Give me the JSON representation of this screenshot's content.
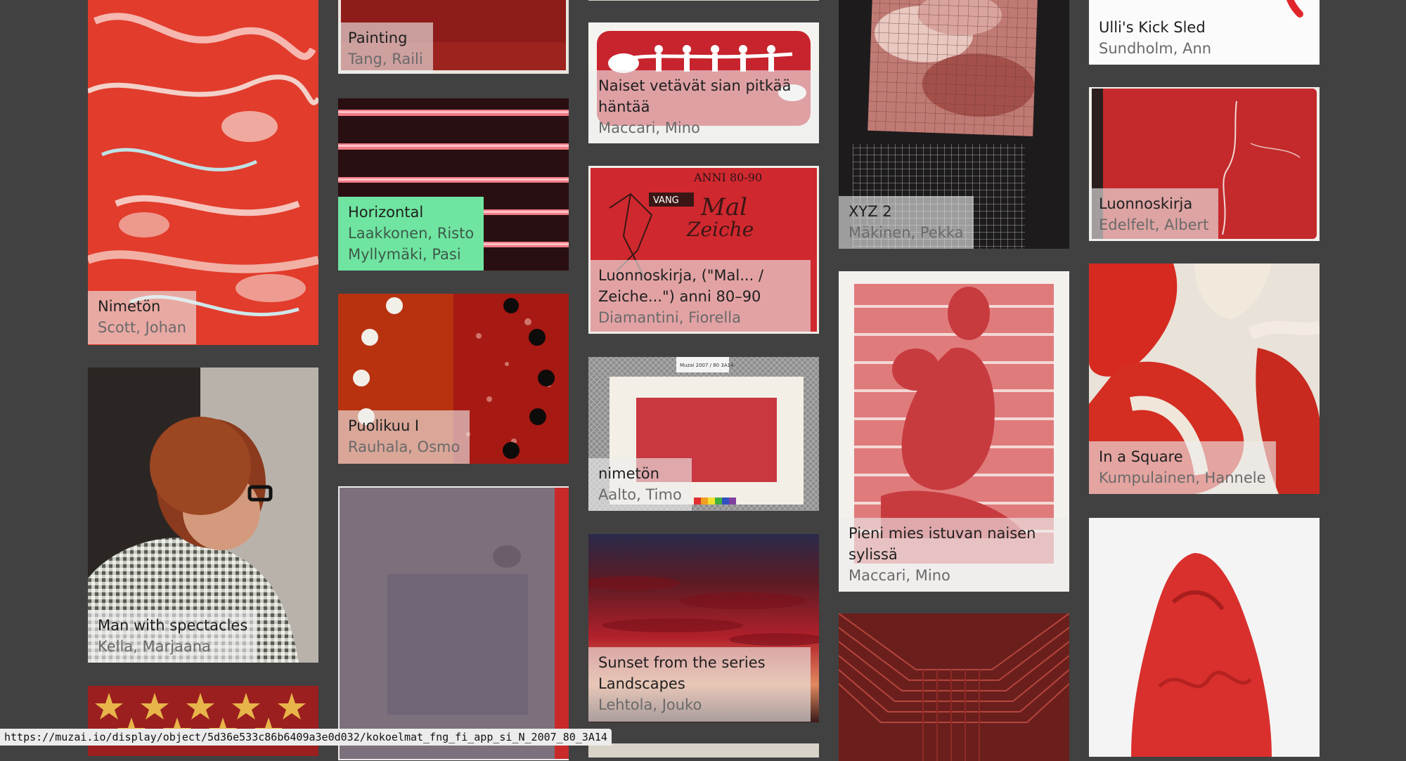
{
  "cards": [
    {
      "title": "Nimetön",
      "artists": [
        "Scott, Johan"
      ]
    },
    {
      "title": "Man with spectacles",
      "artists": [
        "Kella, Marjaana"
      ]
    },
    {
      "title": "Painting",
      "artists": [
        "Tang, Raili"
      ]
    },
    {
      "title": "Horizontal",
      "artists": [
        "Laakkonen, Risto",
        "Myllymäki, Pasi"
      ]
    },
    {
      "title": "Puolikuu I",
      "artists": [
        "Rauhala, Osmo"
      ]
    },
    {
      "title": "Naiset vetävät sian pitkää häntää",
      "artists": [
        "Maccari, Mino"
      ]
    },
    {
      "title": "Luonnoskirja, (\"Mal... / Zeiche...\") anni 80–90",
      "artists": [
        "Diamantini, Fiorella"
      ]
    },
    {
      "title": "nimetön",
      "artists": [
        "Aalto, Timo"
      ]
    },
    {
      "title": "Sunset from the series Landscapes",
      "artists": [
        "Lehtola, Jouko"
      ]
    },
    {
      "title": "XYZ 2",
      "artists": [
        "Mäkinen, Pekka"
      ]
    },
    {
      "title": "Pieni mies istuvan naisen sylissä",
      "artists": [
        "Maccari, Mino"
      ]
    },
    {
      "title": "Ulli's Kick Sled",
      "artists": [
        "Sundholm, Ann"
      ]
    },
    {
      "title": "Luonnoskirja",
      "artists": [
        "Edelfelt, Albert"
      ]
    },
    {
      "title": "In a Square",
      "artists": [
        "Kumpulainen, Hannele"
      ]
    }
  ],
  "sketch_cover_text": {
    "line1": "ANNI 80-90",
    "tag": "VANG",
    "line2": "Mal",
    "line3": "Zeiche"
  },
  "label_sticker_text": "Muzai 2007 / 80 3A14",
  "status_url": "https://muzai.io/display/object/5d36e533c86b6409a3e0d032/kokoelmat_fng_fi_app_si_N_2007_80_3A14",
  "colors": {
    "background": "#414141",
    "caption_bg": "rgba(238,238,238,0.62)",
    "highlight": "#6fe5a1",
    "accent_red": "#c8202a"
  }
}
